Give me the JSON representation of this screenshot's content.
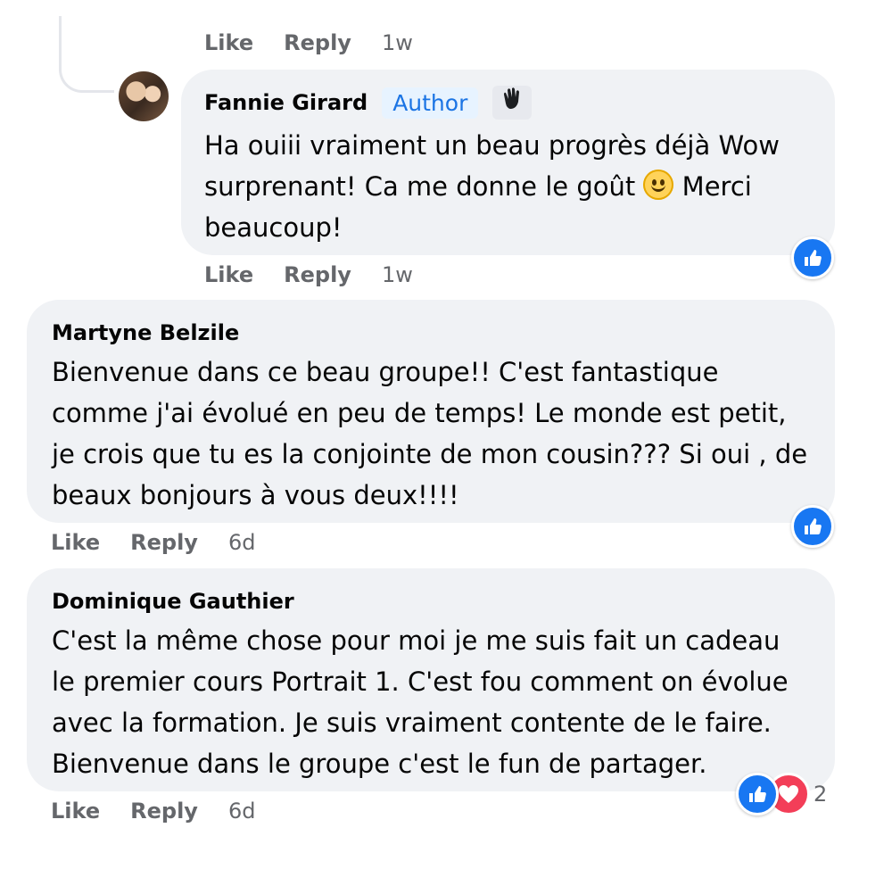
{
  "top_actions": {
    "like": "Like",
    "reply": "Reply",
    "time": "1w"
  },
  "comments": [
    {
      "author": "Fannie Girard",
      "badge": "Author",
      "badge_icon": "waving-hand-icon",
      "text_part1": "Ha ouiii vraiment un beau progrès déjà Wow surprenant! Ca me donne le goût",
      "text_emoji": "slightly-smiling-face-emoji",
      "text_part2": "Merci beaucoup!",
      "like": "Like",
      "reply": "Reply",
      "time": "1w",
      "reactions": [
        "like-icon"
      ]
    },
    {
      "author": "Martyne Belzile",
      "text": "Bienvenue dans ce beau groupe!! C'est fantastique comme j'ai évolué en peu de temps! Le monde est petit, je crois que tu es la conjointe de mon cousin??? Si oui , de beaux bonjours à vous deux!!!!",
      "like": "Like",
      "reply": "Reply",
      "time": "6d",
      "reactions": [
        "like-icon"
      ]
    },
    {
      "author": "Dominique Gauthier",
      "text": "C'est la même chose pour moi je me suis fait un cadeau le premier cours Portrait 1. C'est fou comment on évolue avec la formation. Je suis vraiment contente de le faire. Bienvenue dans le groupe c'est le fun de partager.",
      "like": "Like",
      "reply": "Reply",
      "time": "6d",
      "reactions": [
        "like-icon",
        "heart-icon"
      ],
      "reaction_count": "2"
    }
  ],
  "colors": {
    "bubble": "#f0f2f5",
    "action_text": "#65676b",
    "like_blue": "#1877f2",
    "heart_red": "#f33e58",
    "author_badge_text": "#1b74e4",
    "author_badge_bg": "#e7f3ff"
  }
}
